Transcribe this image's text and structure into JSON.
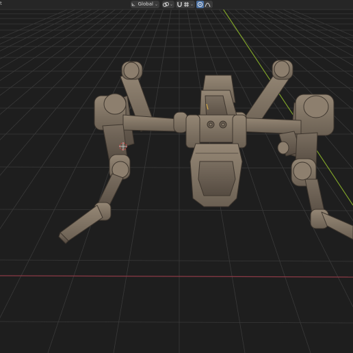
{
  "header": {
    "corner_glyph": "t",
    "transform_orientation": {
      "icon": "transform-orientation-icon",
      "value": "Global",
      "chevron": "chevron-down-icon"
    },
    "pivot": {
      "icon": "pivot-point-icon",
      "chevron": "chevron-down-icon"
    },
    "snapping": {
      "toggle_icon": "magnet-icon",
      "element_icon": "snap-increment-icon",
      "chevron": "chevron-down-icon"
    },
    "proportional_editing": {
      "toggle_icon": "proportional-editing-icon",
      "falloff_icon": "falloff-curve-icon"
    }
  },
  "viewport": {
    "background_color": "#1e1e1e",
    "grid_color": "#3a3a3a",
    "x_axis_color": "#8c3a46",
    "y_axis_color": "#7ea128",
    "model": "mech-spider",
    "model_color": "#7f7263"
  }
}
